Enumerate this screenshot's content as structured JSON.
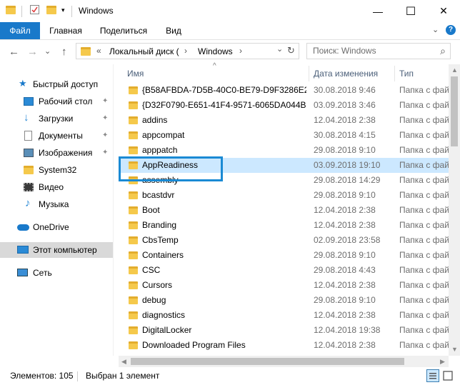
{
  "window": {
    "title": "Windows",
    "minimize_glyph": "—",
    "maximize_glyph": "☐",
    "close_glyph": "✕"
  },
  "ribbon": {
    "tabs": [
      "Файл",
      "Главная",
      "Поделиться",
      "Вид"
    ],
    "expand_glyph": "⌄",
    "help_glyph": "?"
  },
  "nav": {
    "back_glyph": "←",
    "forward_glyph": "→",
    "recent_glyph": "⌄",
    "up_glyph": "↑",
    "address_overflow": "«",
    "address_parts": [
      "Локальный диск (",
      "Windows"
    ],
    "address_sep": "›",
    "address_dropdown": "⌄",
    "refresh_glyph": "↻",
    "search_placeholder": "Поиск: Windows",
    "search_icon": "⌕"
  },
  "sidebar": {
    "items": [
      {
        "label": "Быстрый доступ",
        "icon": "star-icon"
      },
      {
        "label": "Рабочий стол",
        "icon": "desktop-icon",
        "pinned": true
      },
      {
        "label": "Загрузки",
        "icon": "download-icon",
        "pinned": true
      },
      {
        "label": "Документы",
        "icon": "document-icon",
        "pinned": true
      },
      {
        "label": "Изображения",
        "icon": "pictures-icon",
        "pinned": true
      },
      {
        "label": "System32",
        "icon": "folder-icon"
      },
      {
        "label": "Видео",
        "icon": "video-icon"
      },
      {
        "label": "Музыка",
        "icon": "music-icon"
      },
      {
        "label": "OneDrive",
        "icon": "cloud-icon"
      },
      {
        "label": "Этот компьютер",
        "icon": "computer-icon",
        "selected": true
      },
      {
        "label": "Сеть",
        "icon": "network-icon"
      }
    ],
    "pin_glyph": "📌"
  },
  "columns": {
    "name": "Имя",
    "date": "Дата изменения",
    "type": "Тип",
    "sort_glyph": "^"
  },
  "files": [
    {
      "name": "{B58AFBDA-7D5B-40C0-BE79-D9F3286E2...",
      "date": "30.08.2018 9:46",
      "type": "Папка с фай"
    },
    {
      "name": "{D32F0790-E651-41F4-9571-6065DA044B8",
      "date": "03.09.2018 3:46",
      "type": "Папка с фай"
    },
    {
      "name": "addins",
      "date": "12.04.2018 2:38",
      "type": "Папка с фай"
    },
    {
      "name": "appcompat",
      "date": "30.08.2018 4:15",
      "type": "Папка с фай"
    },
    {
      "name": "apppatch",
      "date": "29.08.2018 9:10",
      "type": "Папка с фай"
    },
    {
      "name": "AppReadiness",
      "date": "03.09.2018 19:10",
      "type": "Папка с фай",
      "selected": true
    },
    {
      "name": "assembly",
      "date": "29.08.2018 14:29",
      "type": "Папка с фай"
    },
    {
      "name": "bcastdvr",
      "date": "29.08.2018 9:10",
      "type": "Папка с фай"
    },
    {
      "name": "Boot",
      "date": "12.04.2018 2:38",
      "type": "Папка с фай"
    },
    {
      "name": "Branding",
      "date": "12.04.2018 2:38",
      "type": "Папка с фай"
    },
    {
      "name": "CbsTemp",
      "date": "02.09.2018 23:58",
      "type": "Папка с фай"
    },
    {
      "name": "Containers",
      "date": "29.08.2018 9:10",
      "type": "Папка с фай"
    },
    {
      "name": "CSC",
      "date": "29.08.2018 4:43",
      "type": "Папка с фай"
    },
    {
      "name": "Cursors",
      "date": "12.04.2018 2:38",
      "type": "Папка с фай"
    },
    {
      "name": "debug",
      "date": "29.08.2018 9:10",
      "type": "Папка с фай"
    },
    {
      "name": "diagnostics",
      "date": "12.04.2018 2:38",
      "type": "Папка с фай"
    },
    {
      "name": "DigitalLocker",
      "date": "12.04.2018 19:38",
      "type": "Папка с фай"
    },
    {
      "name": "Downloaded Program Files",
      "date": "12.04.2018 2:38",
      "type": "Папка с фай"
    }
  ],
  "status": {
    "items_count": "Элементов: 105",
    "selected": "Выбран 1 элемент"
  },
  "colors": {
    "accent": "#1979ca",
    "selection": "#cce8ff",
    "highlight_box": "#1a8ad4",
    "folder": "#f5c94c"
  }
}
